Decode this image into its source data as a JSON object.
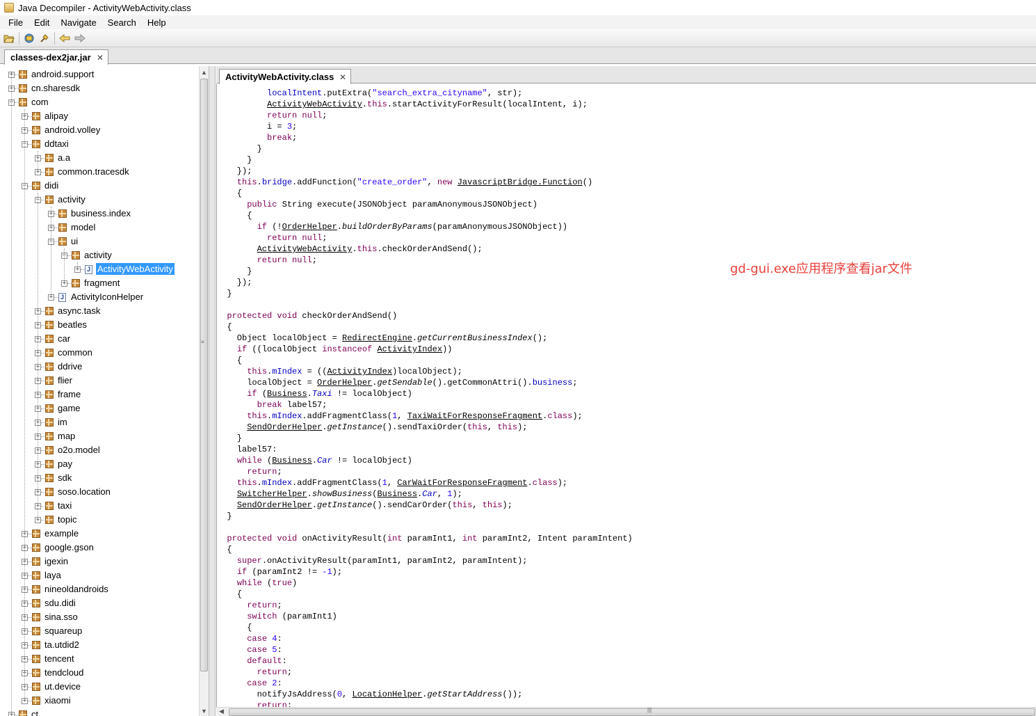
{
  "window": {
    "title": "Java Decompiler - ActivityWebActivity.class"
  },
  "menu": [
    "File",
    "Edit",
    "Navigate",
    "Search",
    "Help"
  ],
  "toolbar": {
    "icons": [
      "open-file-icon",
      "open-type-icon",
      "search-icon",
      "back-icon",
      "forward-icon"
    ]
  },
  "jar_tab": {
    "label": "classes-dex2jar.jar",
    "close": "✕"
  },
  "code_tab": {
    "label": "ActivityWebActivity.class",
    "close": "✕"
  },
  "tree": [
    {
      "label": "android.support",
      "depth": 0,
      "kind": "package",
      "state": "collapsed"
    },
    {
      "label": "cn.sharesdk",
      "depth": 0,
      "kind": "package",
      "state": "collapsed"
    },
    {
      "label": "com",
      "depth": 0,
      "kind": "package",
      "state": "expanded"
    },
    {
      "label": "alipay",
      "depth": 1,
      "kind": "package",
      "state": "collapsed"
    },
    {
      "label": "android.volley",
      "depth": 1,
      "kind": "package",
      "state": "collapsed"
    },
    {
      "label": "ddtaxi",
      "depth": 1,
      "kind": "package",
      "state": "expanded"
    },
    {
      "label": "a.a",
      "depth": 2,
      "kind": "package",
      "state": "collapsed"
    },
    {
      "label": "common.tracesdk",
      "depth": 2,
      "kind": "package",
      "state": "collapsed"
    },
    {
      "label": "didi",
      "depth": 1,
      "kind": "package",
      "state": "expanded"
    },
    {
      "label": "activity",
      "depth": 2,
      "kind": "package",
      "state": "expanded"
    },
    {
      "label": "business.index",
      "depth": 3,
      "kind": "package",
      "state": "collapsed"
    },
    {
      "label": "model",
      "depth": 3,
      "kind": "package",
      "state": "collapsed"
    },
    {
      "label": "ui",
      "depth": 3,
      "kind": "package",
      "state": "expanded"
    },
    {
      "label": "activity",
      "depth": 4,
      "kind": "package",
      "state": "expanded"
    },
    {
      "label": "ActivityWebActivity",
      "depth": 5,
      "kind": "class",
      "state": "collapsed",
      "selected": true
    },
    {
      "label": "fragment",
      "depth": 4,
      "kind": "package",
      "state": "collapsed"
    },
    {
      "label": "ActivityIconHelper",
      "depth": 3,
      "kind": "class",
      "state": "collapsed"
    },
    {
      "label": "async.task",
      "depth": 2,
      "kind": "package",
      "state": "collapsed"
    },
    {
      "label": "beatles",
      "depth": 2,
      "kind": "package",
      "state": "collapsed"
    },
    {
      "label": "car",
      "depth": 2,
      "kind": "package",
      "state": "collapsed"
    },
    {
      "label": "common",
      "depth": 2,
      "kind": "package",
      "state": "collapsed"
    },
    {
      "label": "ddrive",
      "depth": 2,
      "kind": "package",
      "state": "collapsed"
    },
    {
      "label": "flier",
      "depth": 2,
      "kind": "package",
      "state": "collapsed"
    },
    {
      "label": "frame",
      "depth": 2,
      "kind": "package",
      "state": "collapsed"
    },
    {
      "label": "game",
      "depth": 2,
      "kind": "package",
      "state": "collapsed"
    },
    {
      "label": "im",
      "depth": 2,
      "kind": "package",
      "state": "collapsed"
    },
    {
      "label": "map",
      "depth": 2,
      "kind": "package",
      "state": "collapsed"
    },
    {
      "label": "o2o.model",
      "depth": 2,
      "kind": "package",
      "state": "collapsed"
    },
    {
      "label": "pay",
      "depth": 2,
      "kind": "package",
      "state": "collapsed"
    },
    {
      "label": "sdk",
      "depth": 2,
      "kind": "package",
      "state": "collapsed"
    },
    {
      "label": "soso.location",
      "depth": 2,
      "kind": "package",
      "state": "collapsed"
    },
    {
      "label": "taxi",
      "depth": 2,
      "kind": "package",
      "state": "collapsed"
    },
    {
      "label": "topic",
      "depth": 2,
      "kind": "package",
      "state": "collapsed"
    },
    {
      "label": "example",
      "depth": 1,
      "kind": "package",
      "state": "collapsed"
    },
    {
      "label": "google.gson",
      "depth": 1,
      "kind": "package",
      "state": "collapsed"
    },
    {
      "label": "igexin",
      "depth": 1,
      "kind": "package",
      "state": "collapsed"
    },
    {
      "label": "laya",
      "depth": 1,
      "kind": "package",
      "state": "collapsed"
    },
    {
      "label": "nineoldandroids",
      "depth": 1,
      "kind": "package",
      "state": "collapsed"
    },
    {
      "label": "sdu.didi",
      "depth": 1,
      "kind": "package",
      "state": "collapsed"
    },
    {
      "label": "sina.sso",
      "depth": 1,
      "kind": "package",
      "state": "collapsed"
    },
    {
      "label": "squareup",
      "depth": 1,
      "kind": "package",
      "state": "collapsed"
    },
    {
      "label": "ta.utdid2",
      "depth": 1,
      "kind": "package",
      "state": "collapsed"
    },
    {
      "label": "tencent",
      "depth": 1,
      "kind": "package",
      "state": "collapsed"
    },
    {
      "label": "tendcloud",
      "depth": 1,
      "kind": "package",
      "state": "collapsed"
    },
    {
      "label": "ut.device",
      "depth": 1,
      "kind": "package",
      "state": "collapsed"
    },
    {
      "label": "xiaomi",
      "depth": 1,
      "kind": "package",
      "state": "collapsed"
    },
    {
      "label": "ct",
      "depth": 0,
      "kind": "package",
      "state": "collapsed"
    }
  ],
  "code_lines": [
    "          <f>localIntent</f>.putExtra(<s>\"search_extra_cityname\"</s>, str);",
    "          <u>ActivityWebActivity</u>.<k>this</k>.startActivityForResult(localIntent, i);",
    "          <k>return null</k>;",
    "          i = <n>3</n>;",
    "          <k>break</k>;",
    "        }",
    "      }",
    "    });",
    "    <k>this</k>.<f>bridge</f>.addFunction(<s>\"create_order\"</s>, <k>new</k> <u>JavascriptBridge.Function</u>()",
    "    {",
    "      <k>public</k> String execute(JSONObject paramAnonymousJSONObject)",
    "      {",
    "        <k>if</k> (!<u>OrderHelper</u>.<i>buildOrderByParams</i>(paramAnonymousJSONObject))",
    "          <k>return null</k>;",
    "        <u>ActivityWebActivity</u>.<k>this</k>.checkOrderAndSend();",
    "        <k>return null</k>;",
    "      }",
    "    });",
    "  }",
    "",
    "  <k>protected void</k> checkOrderAndSend()",
    "  {",
    "    Object localObject = <u>RedirectEngine</u>.<i>getCurrentBusinessIndex</i>();",
    "    <k>if</k> ((localObject <k>instanceof</k> <u>ActivityIndex</u>))",
    "    {",
    "      <k>this</k>.<f>mIndex</f> = ((<u>ActivityIndex</u>)localObject);",
    "      localObject = <u>OrderHelper</u>.<i>getSendable</i>().getCommonAttri().<f>business</f>;",
    "      <k>if</k> (<u>Business</u>.<f><i>Taxi</i></f> != localObject)",
    "        <k>break</k> label57;",
    "      <k>this</k>.<f>mIndex</f>.addFragmentClass(<n>1</n>, <u>TaxiWaitForResponseFragment</u>.<k>class</k>);",
    "      <u>SendOrderHelper</u>.<i>getInstance</i>().sendTaxiOrder(<k>this</k>, <k>this</k>);",
    "    }",
    "    label57:",
    "    <k>while</k> (<u>Business</u>.<f><i>Car</i></f> != localObject)",
    "      <k>return</k>;",
    "    <k>this</k>.<f>mIndex</f>.addFragmentClass(<n>1</n>, <u>CarWaitForResponseFragment</u>.<k>class</k>);",
    "    <u>SwitcherHelper</u>.<i>showBusiness</i>(<u>Business</u>.<f><i>Car</i></f>, <n>1</n>);",
    "    <u>SendOrderHelper</u>.<i>getInstance</i>().sendCarOrder(<k>this</k>, <k>this</k>);",
    "  }",
    "",
    "  <k>protected void</k> onActivityResult(<k>int</k> paramInt1, <k>int</k> paramInt2, Intent paramIntent)",
    "  {",
    "    <k>super</k>.onActivityResult(paramInt1, paramInt2, paramIntent);",
    "    <k>if</k> (paramInt2 != <n>-1</n>);",
    "    <k>while</k> (<k>true</k>)",
    "    {",
    "      <k>return</k>;",
    "      <k>switch</k> (paramInt1)",
    "      {",
    "      <k>case</k> <n>4</n>:",
    "      <k>case</k> <n>5</n>:",
    "      <k>default</k>:",
    "        <k>return</k>;",
    "      <k>case</k> <n>2</n>:",
    "        notifyJsAddress(<n>0</n>, <u>LocationHelper</u>.<i>getStartAddress</i>());",
    "        <k>return</k>;"
  ],
  "annotation": "gd-gui.exe应用程序查看jar文件"
}
